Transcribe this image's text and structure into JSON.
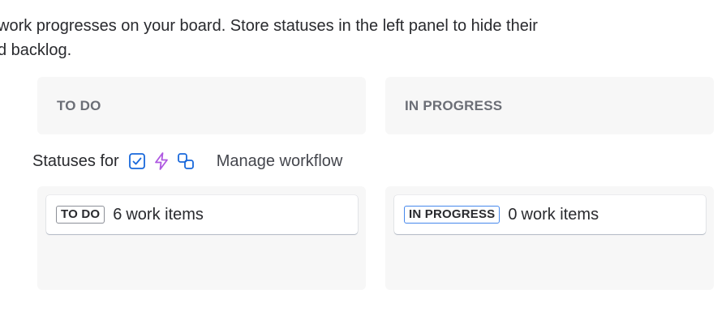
{
  "description": {
    "line1": "work progresses on your board. Store statuses in the left panel to hide their",
    "line2": "d backlog."
  },
  "columns": [
    {
      "header": "TO DO"
    },
    {
      "header": "IN PROGRESS"
    }
  ],
  "statuses_row": {
    "label": "Statuses for",
    "icons": [
      "checkbox-icon",
      "lightning-icon",
      "subtask-icon"
    ],
    "manage_label": "Manage workflow"
  },
  "lanes": [
    {
      "lozenge": "TO DO",
      "count": "6",
      "items_label": "work items",
      "lozenge_color": "#8c8f97"
    },
    {
      "lozenge": "IN PROGRESS",
      "count": "0",
      "items_label": "work items",
      "lozenge_color": "#4688ec"
    }
  ],
  "colors": {
    "checkbox_icon": "#1868db",
    "lightning_icon": "#af59e1",
    "subtask_icon": "#1868db"
  }
}
